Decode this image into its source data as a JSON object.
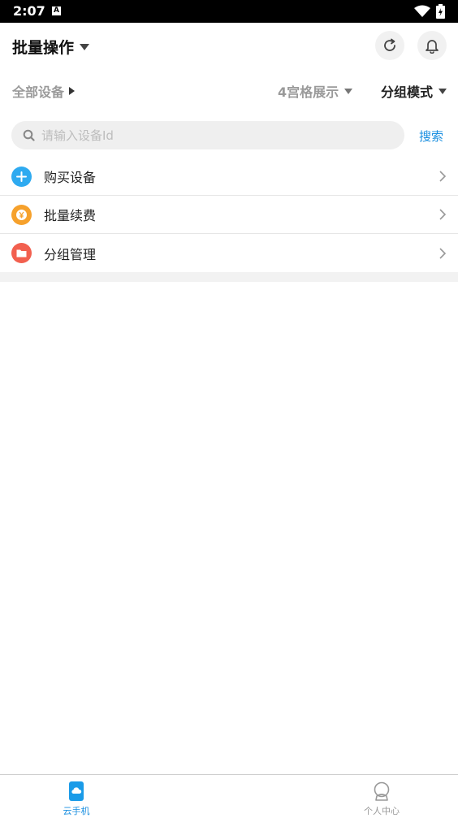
{
  "status_bar": {
    "time": "2:07",
    "notif_letter": "A"
  },
  "header": {
    "title": "批量操作"
  },
  "filters": {
    "all_devices": "全部设备",
    "grid_display": "4宫格展示",
    "group_mode": "分组模式"
  },
  "search": {
    "placeholder": "请输入设备Id",
    "value": "",
    "button_label": "搜索"
  },
  "menu": {
    "items": [
      {
        "label": "购买设备",
        "icon": "plus-icon",
        "color": "#2eaaf0"
      },
      {
        "label": "批量续费",
        "icon": "yuan-coin-icon",
        "color": "#f6a12c"
      },
      {
        "label": "分组管理",
        "icon": "folder-icon",
        "color": "#f2604f"
      }
    ]
  },
  "tabbar": {
    "tabs": [
      {
        "label": "云手机",
        "icon": "cloud-phone-icon",
        "active": true
      },
      {
        "label": "个人中心",
        "icon": "person-icon",
        "active": false
      }
    ]
  },
  "colors": {
    "accent": "#1a8fe0"
  }
}
